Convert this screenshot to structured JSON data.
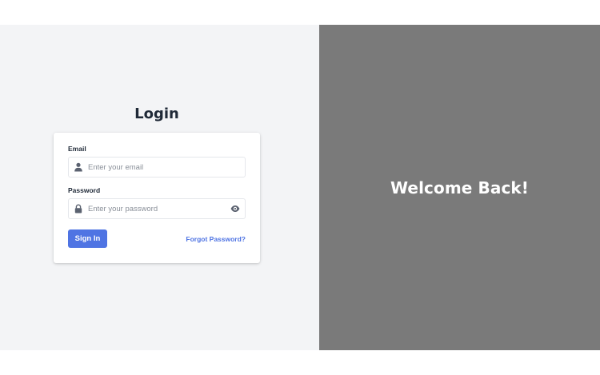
{
  "login": {
    "title": "Login",
    "email_label": "Email",
    "email_value": "",
    "email_placeholder": "Enter your email",
    "password_label": "Password",
    "password_value": "",
    "password_placeholder": "Enter your password",
    "signin_label": "Sign In",
    "forgot_label": "Forgot Password?"
  },
  "welcome": {
    "heading": "Welcome Back!"
  },
  "icons": {
    "email": "user-icon",
    "password": "lock-icon",
    "toggle_password": "eye-icon"
  },
  "colors": {
    "accent": "#4f74e3",
    "left_background": "#f3f4f6",
    "right_background": "#7a7a7a",
    "heading_text": "#1f2937"
  }
}
